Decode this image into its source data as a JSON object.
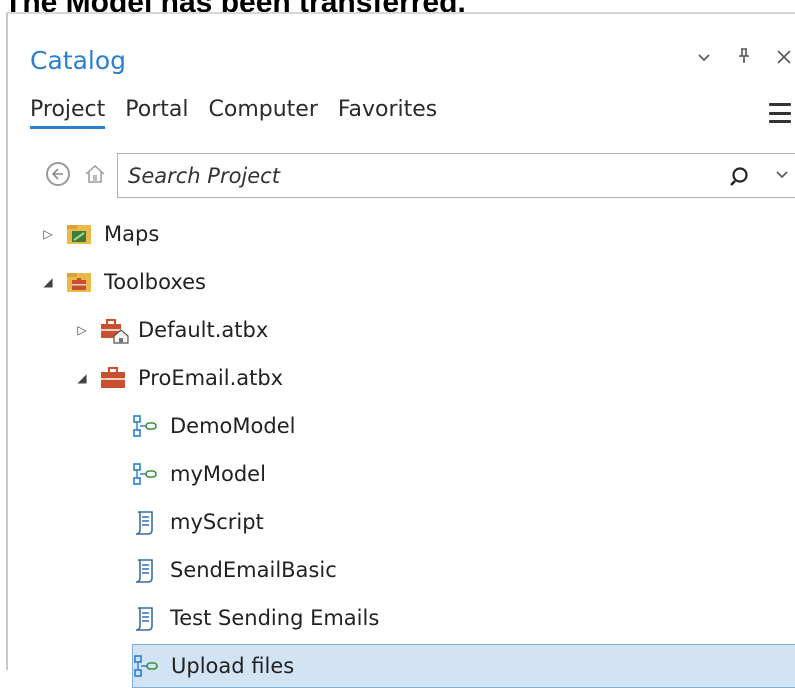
{
  "caption": "The Model has been transferred.",
  "pane": {
    "title": "Catalog",
    "controls": {
      "dropdown": "⌄",
      "pin": "⊥",
      "close": "✕"
    },
    "tabs": [
      {
        "label": "Project"
      },
      {
        "label": "Portal"
      },
      {
        "label": "Computer"
      },
      {
        "label": "Favorites"
      }
    ]
  },
  "search": {
    "placeholder": "Search Project",
    "value": ""
  },
  "tree": {
    "maps": "Maps",
    "toolboxes": "Toolboxes",
    "default_atbx": "Default.atbx",
    "proemail_atbx": "ProEmail.atbx",
    "items": [
      {
        "label": "DemoModel",
        "icon": "model-icon"
      },
      {
        "label": "myModel",
        "icon": "model-icon"
      },
      {
        "label": "myScript",
        "icon": "script-icon"
      },
      {
        "label": "SendEmailBasic",
        "icon": "script-icon"
      },
      {
        "label": "Test Sending Emails",
        "icon": "script-icon"
      },
      {
        "label": "Upload files",
        "icon": "model-icon"
      }
    ]
  },
  "colors": {
    "accent": "#2b7fd1",
    "selected_bg": "#d2e4f4",
    "folder": "#e9b949",
    "toolbox": "#c8502e"
  }
}
